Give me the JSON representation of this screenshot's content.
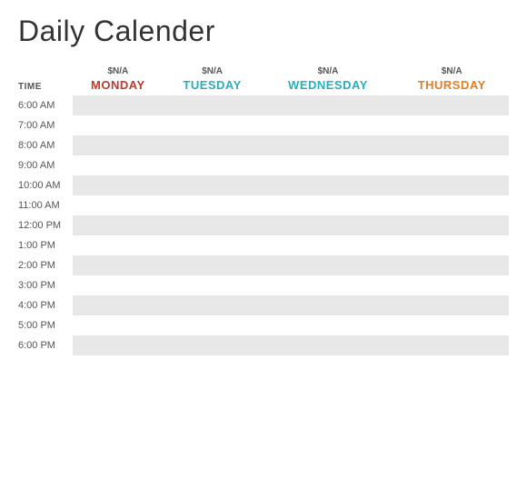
{
  "title": "Daily Calender",
  "columns": {
    "time_label": "TIME",
    "days": [
      {
        "na": "$N/A",
        "name": "MONDAY",
        "class": "day-monday"
      },
      {
        "na": "$N/A",
        "name": "TUESDAY",
        "class": "day-tuesday"
      },
      {
        "na": "$N/A",
        "name": "WEDNESDAY",
        "class": "day-wednesday"
      },
      {
        "na": "$N/A",
        "name": "THURSDAY",
        "class": "day-thursday"
      }
    ]
  },
  "time_slots": [
    {
      "label": "6:00 AM",
      "shaded": true
    },
    {
      "label": "7:00 AM",
      "shaded": false
    },
    {
      "label": "8:00 AM",
      "shaded": true
    },
    {
      "label": "9:00 AM",
      "shaded": false
    },
    {
      "label": "10:00 AM",
      "shaded": true
    },
    {
      "label": "11:00 AM",
      "shaded": false
    },
    {
      "label": "12:00 PM",
      "shaded": true
    },
    {
      "label": "1:00 PM",
      "shaded": false
    },
    {
      "label": "2:00 PM",
      "shaded": true
    },
    {
      "label": "3:00 PM",
      "shaded": false
    },
    {
      "label": "4:00 PM",
      "shaded": true
    },
    {
      "label": "5:00 PM",
      "shaded": false
    },
    {
      "label": "6:00 PM",
      "shaded": true
    }
  ]
}
